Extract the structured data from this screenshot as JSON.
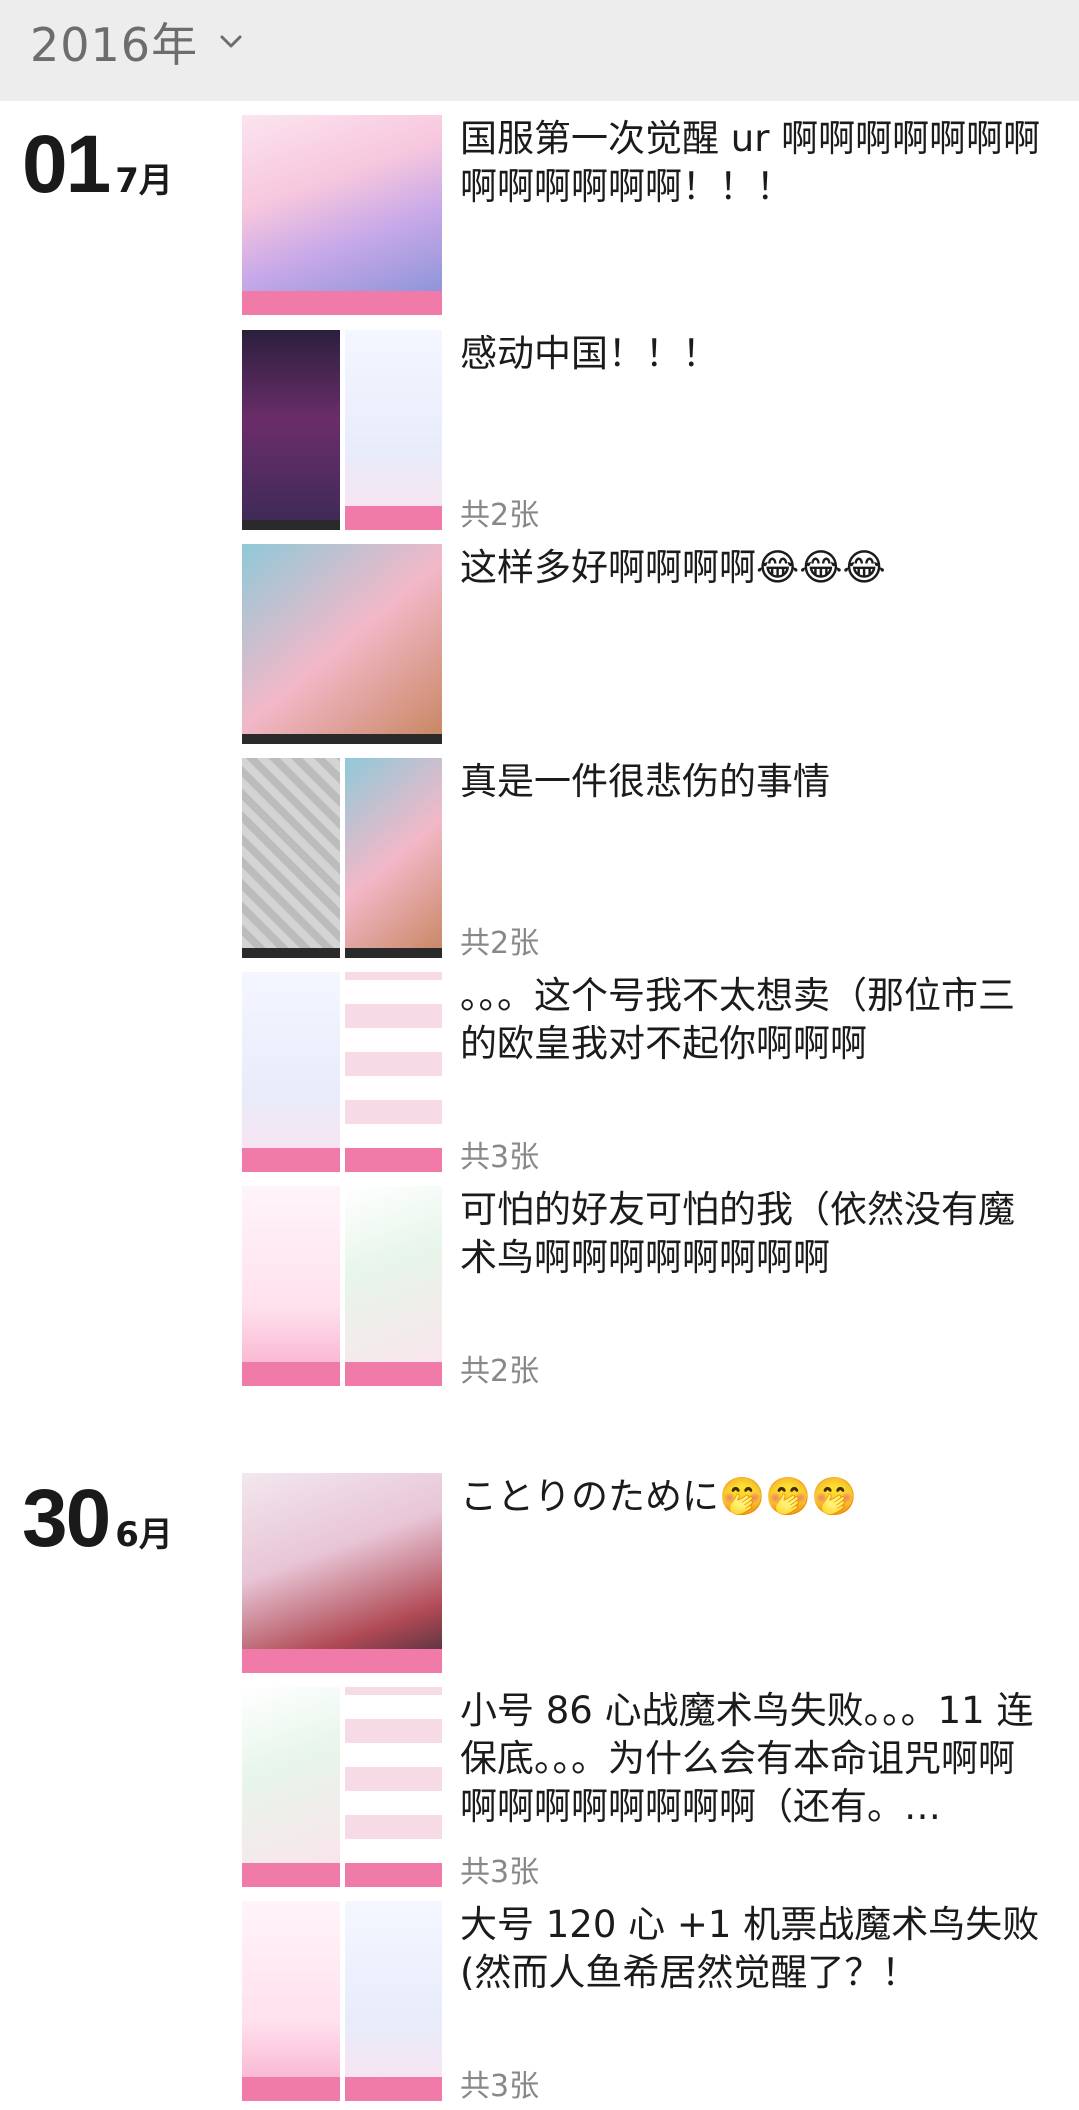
{
  "header": {
    "year": "2016年"
  },
  "groups": [
    {
      "day": "01",
      "month": "7月",
      "posts": [
        {
          "text": "国服第一次觉醒 ur 啊啊啊啊啊啊啊啊啊啊啊啊啊！！！",
          "count": ""
        },
        {
          "text": "感动中国！！！",
          "count": "共2张"
        },
        {
          "text": "这样多好啊啊啊啊😂😂😂",
          "count": ""
        },
        {
          "text": "真是一件很悲伤的事情",
          "count": "共2张"
        },
        {
          "text": "。。。这个号我不太想卖（那位市三的欧皇我对不起你啊啊啊",
          "count": "共3张"
        },
        {
          "text": "可怕的好友可怕的我（依然没有魔术鸟啊啊啊啊啊啊啊啊",
          "count": "共2张"
        }
      ]
    },
    {
      "day": "30",
      "month": "6月",
      "posts": [
        {
          "text": "ことりのために🤭🤭🤭",
          "count": ""
        },
        {
          "text": "小号 86 心战魔术鸟失败。。。11 连保底。。。为什么会有本命诅咒啊啊啊啊啊啊啊啊啊啊（还有。…",
          "count": "共3张"
        },
        {
          "text": "大号 120 心 +1 机票战魔术鸟失败(然而人鱼希居然觉醒了？！",
          "count": "共3张"
        }
      ]
    }
  ],
  "colors": {
    "topbar_bg": "#ededed",
    "count_text": "#888888",
    "date_text": "#1a1a1a"
  },
  "icons": {
    "year_dropdown": "chevron-down-icon"
  }
}
